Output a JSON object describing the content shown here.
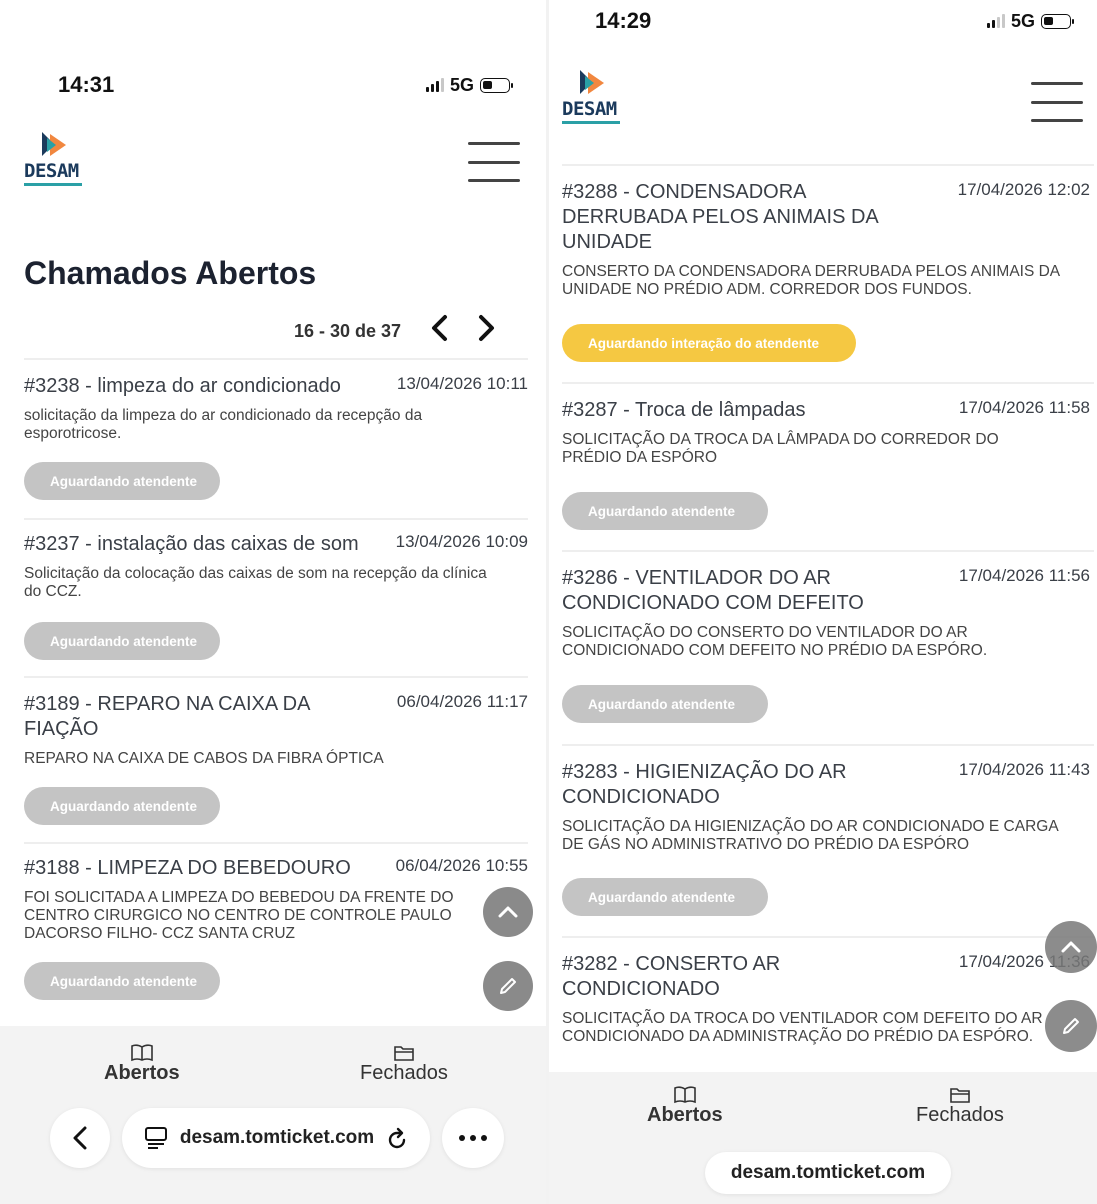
{
  "left": {
    "status": {
      "time": "14:31",
      "network": "5G"
    },
    "logo": {
      "text": "DESAM"
    },
    "page_title": "Chamados Abertos",
    "pager": {
      "range": "16 - 30 de 37",
      "prev": "‹",
      "next": "›"
    },
    "tickets": [
      {
        "title": "#3238 - limpeza do ar condicionado",
        "date": "13/04/2026 10:11",
        "desc": "solicitação da limpeza do ar condicionado da recepção da esporotricose.",
        "status": "Aguardando atendente"
      },
      {
        "title": "#3237 - instalação das caixas de som",
        "date": "13/04/2026 10:09",
        "desc": "Solicitação da colocação das caixas de som na recepção da clínica do CCZ.",
        "status": "Aguardando atendente"
      },
      {
        "title": "#3189 - REPARO NA CAIXA DA FIAÇÃO",
        "date": "06/04/2026 11:17",
        "desc": "REPARO NA CAIXA DE CABOS DA FIBRA ÓPTICA",
        "status": "Aguardando atendente"
      },
      {
        "title": "#3188 - LIMPEZA DO BEBEDOURO",
        "date": "06/04/2026 10:55",
        "desc": "FOI SOLICITADA A LIMPEZA DO BEBEDOU DA FRENTE DO CENTRO CIRURGICO NO CENTRO DE CONTROLE PAULO DACORSO FILHO- CCZ SANTA CRUZ",
        "status": "Aguardando atendente"
      }
    ],
    "nav": {
      "open": "Abertos",
      "closed": "Fechados"
    },
    "browser": {
      "url": "desam.tomticket.com"
    }
  },
  "right": {
    "status": {
      "time": "14:29",
      "network": "5G"
    },
    "logo": {
      "text": "DESAM"
    },
    "tickets": [
      {
        "title": "#3288 - CONDENSADORA DERRUBADA PELOS ANIMAIS DA UNIDADE",
        "date": "17/04/2026 12:02",
        "desc": "CONSERTO DA CONDENSADORA DERRUBADA PELOS ANIMAIS DA UNIDADE NO PRÉDIO ADM. CORREDOR DOS FUNDOS.",
        "status": "Aguardando interação do atendente"
      },
      {
        "title": "#3287 - Troca de lâmpadas",
        "date": "17/04/2026 11:58",
        "desc": "SOLICITAÇÃO DA TROCA DA LÂMPADA DO CORREDOR DO PRÉDIO DA ESPÓRO",
        "status": "Aguardando atendente"
      },
      {
        "title": "#3286 - VENTILADOR DO AR CONDICIONADO COM DEFEITO",
        "date": "17/04/2026 11:56",
        "desc": "SOLICITAÇÃO DO CONSERTO DO VENTILADOR DO AR CONDICIONADO COM DEFEITO NO PRÉDIO DA ESPÓRO.",
        "status": "Aguardando atendente"
      },
      {
        "title": "#3283 - HIGIENIZAÇÃO DO AR CONDICIONADO",
        "date": "17/04/2026 11:43",
        "desc": "SOLICITAÇÃO DA HIGIENIZAÇÃO DO AR CONDICIONADO E CARGA DE GÁS NO ADMINISTRATIVO DO PRÉDIO DA ESPÓRO",
        "status": "Aguardando atendente"
      },
      {
        "title": "#3282 - CONSERTO AR CONDICIONADO",
        "date": "17/04/2026 11:36",
        "desc": "SOLICITAÇÃO DA TROCA DO VENTILADOR COM DEFEITO DO AR CONDICIONADO DA ADMINISTRAÇÃO DO PRÉDIO DA ESPÓRO.",
        "status": ""
      }
    ],
    "nav": {
      "open": "Abertos",
      "closed": "Fechados"
    },
    "browser": {
      "url": "desam.tomticket.com"
    }
  },
  "colors": {
    "badge_grey": "#c4c4c4",
    "badge_yellow": "#f5c842",
    "logo_navy": "#1b3a5c",
    "logo_teal": "#2aa0a6",
    "logo_orange": "#f07a2a"
  },
  "icons": [
    "chevron-up-icon",
    "pencil-icon",
    "book-icon",
    "folder-icon",
    "back-icon",
    "tabs-icon",
    "reload-icon",
    "more-icon",
    "signal-icon",
    "battery-icon",
    "hamburger-icon"
  ]
}
